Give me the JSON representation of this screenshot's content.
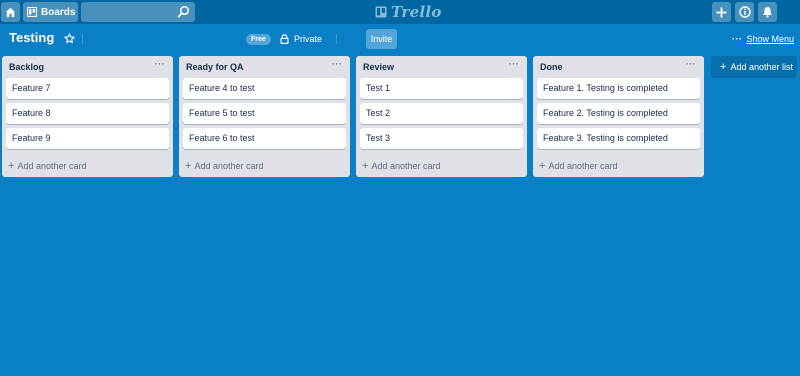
{
  "header": {
    "boards_label": "Boards",
    "search": {
      "value": "",
      "placeholder": ""
    },
    "logo_text": "Trello",
    "icons": {
      "home": "home-icon",
      "boards": "board-icon",
      "search": "search-icon",
      "add": "plus-icon",
      "info": "info-icon",
      "notifications": "bell-icon"
    }
  },
  "board": {
    "title": "Testing",
    "badge": "Free",
    "visibility": "Private",
    "invite_label": "Invite",
    "show_menu_dots": "···",
    "show_menu_label": "Show Menu"
  },
  "lists": [
    {
      "title": "Backlog",
      "menu": "···",
      "cards": [
        "Feature 7",
        "Feature 8",
        "Feature 9"
      ],
      "add_card_label": "Add another card"
    },
    {
      "title": "Ready for QA",
      "menu": "···",
      "cards": [
        "Feature 4 to test",
        "Feature 5 to test",
        "Feature 6 to test"
      ],
      "add_card_label": "Add another card"
    },
    {
      "title": "Review",
      "menu": "···",
      "cards": [
        "Test 1",
        "Test 2",
        "Test 3"
      ],
      "add_card_label": "Add another card"
    },
    {
      "title": "Done",
      "menu": "···",
      "cards": [
        "Feature 1. Testing is completed",
        "Feature 2. Testing is completed",
        "Feature 3. Testing is completed"
      ],
      "add_card_label": "Add another card"
    }
  ],
  "add_list_label": "Add another list",
  "colors": {
    "board_background": "#0a7fc6",
    "header_background": "#0067a3",
    "list_background": "#dfe1e6",
    "card_background": "#ffffff"
  }
}
